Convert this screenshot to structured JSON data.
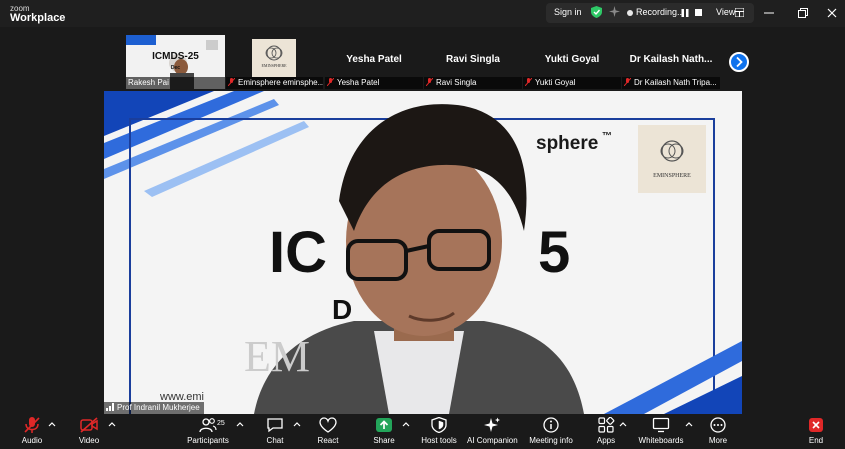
{
  "app": {
    "logo_top": "zoom",
    "logo_bottom": "Workplace"
  },
  "titlebar": {
    "sign_in": "Sign in",
    "recording": "Recording...",
    "view": "View"
  },
  "strip": {
    "tiles": [
      {
        "name": "Rakesh Pai",
        "big": "",
        "muted": false
      },
      {
        "name": "Eminsphere eminsphe...",
        "big": "",
        "muted": true
      },
      {
        "name": "Yesha Patel",
        "big": "Yesha Patel",
        "muted": true
      },
      {
        "name": "Ravi Singla",
        "big": "Ravi Singla",
        "muted": true
      },
      {
        "name": "Yukti Goyal",
        "big": "Yukti Goyal",
        "muted": true
      },
      {
        "name": "Dr Kailash Nath Tripa...",
        "big": "Dr Kailash Nath...",
        "muted": true
      }
    ],
    "thumb1_text": "ICMDS-25",
    "thumb1_sub": "Dec",
    "thumb2_brand": "EMINSPHERE"
  },
  "main": {
    "slide_title_left": "IC",
    "slide_title_right": "5",
    "slide_brand": "sphere",
    "slide_tm": "™",
    "slide_logo": "EMINSPHERE",
    "slide_d": "D",
    "slide_em": "EM",
    "slide_url": "www.emi",
    "speaker_name": "Prof Indranil Mukherjee"
  },
  "toolbar": {
    "audio": "Audio",
    "video": "Video",
    "participants": "Participants",
    "participant_count": "25",
    "chat": "Chat",
    "react": "React",
    "share": "Share",
    "host_tools": "Host tools",
    "ai_companion": "AI Companion",
    "meeting_info": "Meeting info",
    "apps": "Apps",
    "whiteboards": "Whiteboards",
    "more": "More",
    "end": "End"
  },
  "colors": {
    "accent": "#0e72ed",
    "share_green": "#23a55a",
    "muted_red": "#e02828",
    "shield_green": "#2ec866",
    "end_red": "#e02828"
  }
}
